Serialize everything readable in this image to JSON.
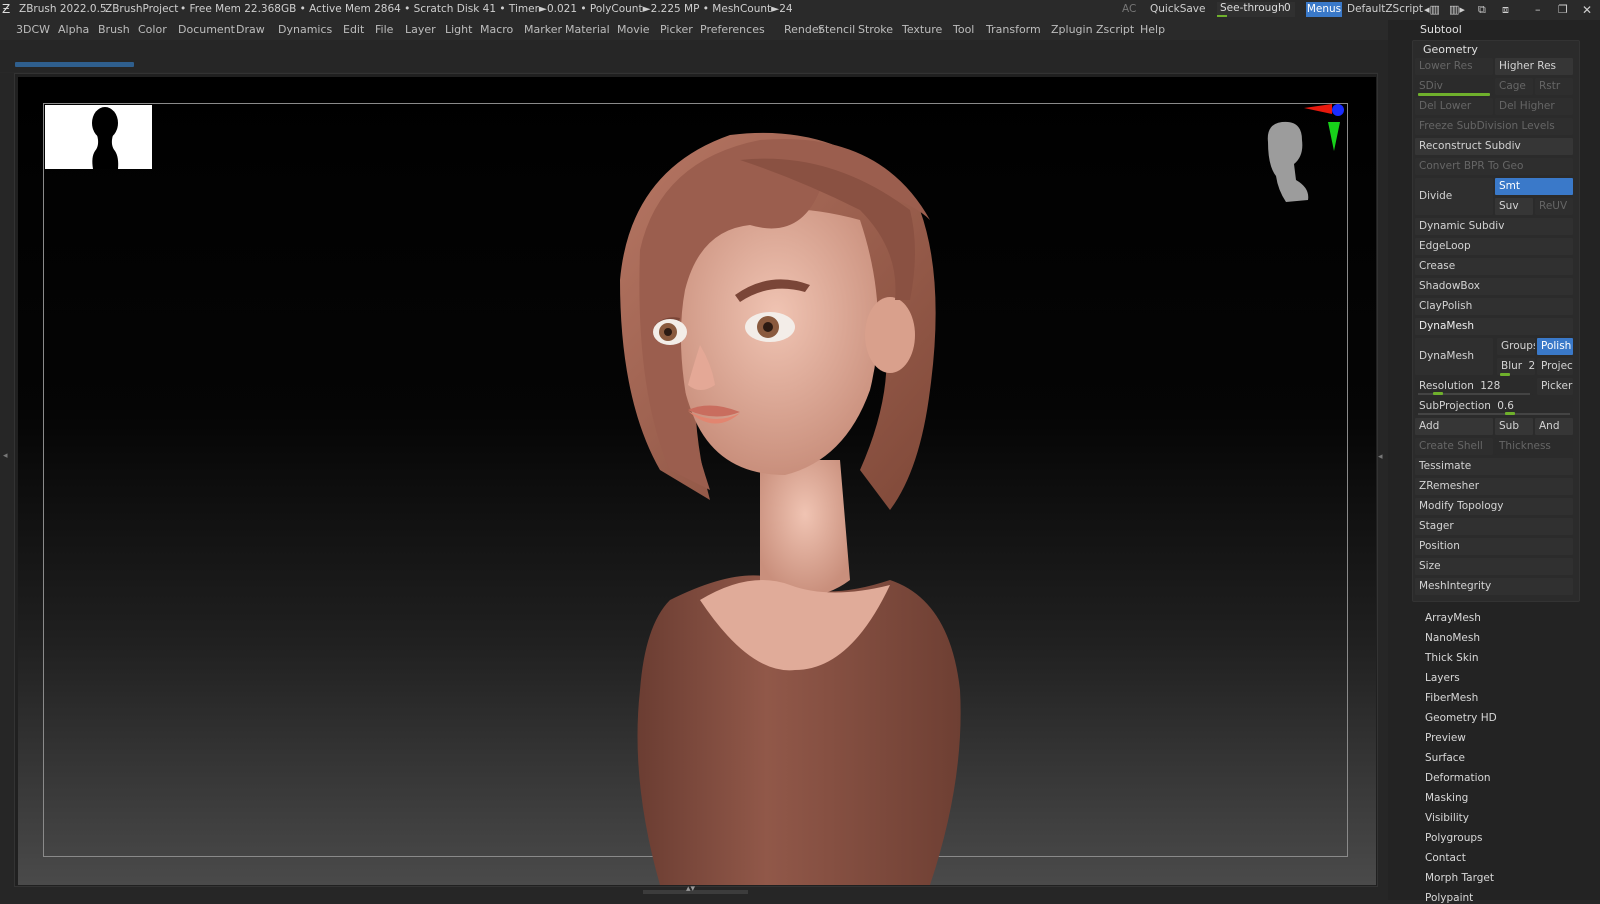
{
  "titlebar": {
    "app": "ZBrush 2022.0.5",
    "project": "ZBrushProject",
    "stats": "• Free Mem 22.368GB • Active Mem 2864 • Scratch Disk 41 • Timer►0.021 • PolyCount►2.225 MP • MeshCount►24",
    "ac": "AC",
    "quicksave": "QuickSave",
    "see_through": "See-through",
    "see_through_value": "0",
    "menus": "Menus",
    "script": "DefaultZScript"
  },
  "menubar": [
    "3DCW",
    "Alpha",
    "Brush",
    "Color",
    "Document",
    "Draw",
    "Dynamics",
    "Edit",
    "File",
    "Layer",
    "Light",
    "Macro",
    "Marker",
    "Material",
    "Movie",
    "Picker",
    "Preferences",
    "Render",
    "Stencil",
    "Stroke",
    "Texture",
    "Tool",
    "Transform",
    "Zplugin",
    "Zscript",
    "Help"
  ],
  "panel": {
    "subtool": "Subtool",
    "geometry": "Geometry",
    "lower_res": "Lower Res",
    "higher_res": "Higher Res",
    "sdiv": "SDiv",
    "cage": "Cage",
    "rstr": "Rstr",
    "del_lower": "Del Lower",
    "del_higher": "Del Higher",
    "freeze": "Freeze SubDivision Levels",
    "reconstruct": "Reconstruct Subdiv",
    "convert_bpr": "Convert BPR To Geo",
    "divide": "Divide",
    "smt": "Smt",
    "suv": "Suv",
    "reuv": "ReUV",
    "dynamic_subdiv": "Dynamic Subdiv",
    "edgeloop": "EdgeLoop",
    "crease": "Crease",
    "shadowbox": "ShadowBox",
    "claypolish": "ClayPolish",
    "dynamesh_header": "DynaMesh",
    "dynamesh": "DynaMesh",
    "groups": "Groups",
    "polish": "Polish",
    "blur": "Blur",
    "blur_value": "2",
    "project": "Project",
    "resolution": "Resolution",
    "resolution_value": "128",
    "picker": "Picker",
    "subprojection": "SubProjection",
    "subprojection_value": "0.6",
    "add": "Add",
    "sub": "Sub",
    "and": "And",
    "create_shell": "Create Shell",
    "thickness": "Thickness",
    "tessimate": "Tessimate",
    "zremesher": "ZRemesher",
    "modify_topology": "Modify Topology",
    "stager": "Stager",
    "position": "Position",
    "size": "Size",
    "meshintegrity": "MeshIntegrity"
  },
  "subpalettes": [
    "ArrayMesh",
    "NanoMesh",
    "Thick Skin",
    "Layers",
    "FiberMesh",
    "Geometry HD",
    "Preview",
    "Surface",
    "Deformation",
    "Masking",
    "Visibility",
    "Polygroups",
    "Contact",
    "Morph Target",
    "Polypaint"
  ],
  "colors": {
    "accent_blue": "#3a79c9",
    "slider_green": "#6fb02c",
    "skin": "#e3b3a3",
    "hair": "#9b5e4e",
    "shirt": "#8a5244"
  }
}
